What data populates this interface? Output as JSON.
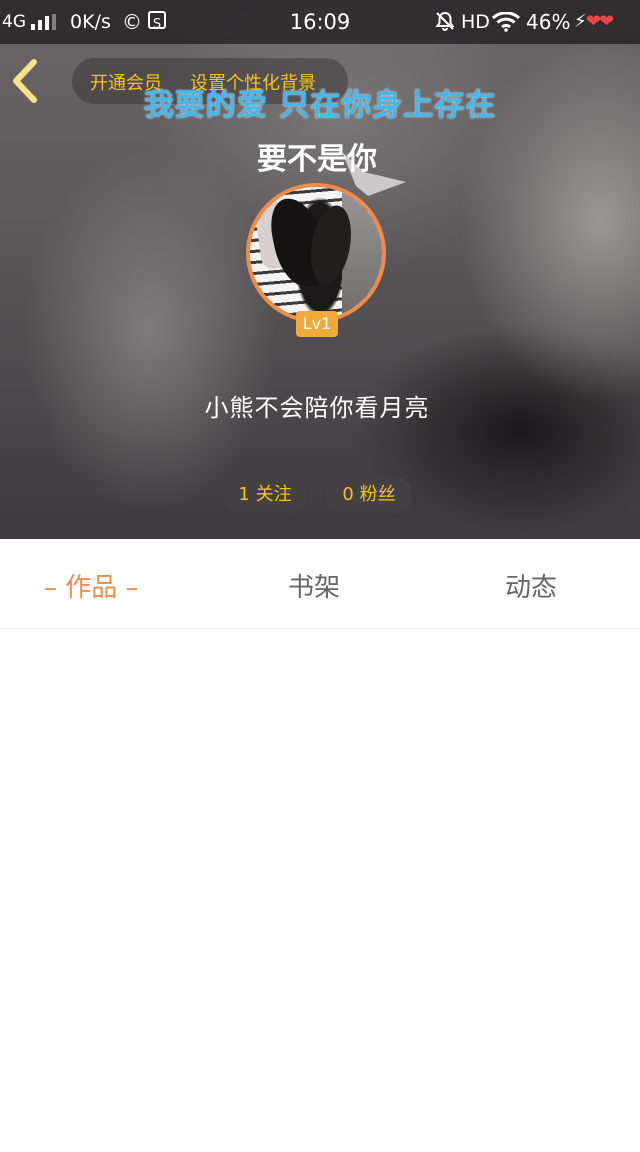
{
  "status_bar": {
    "network": "4G",
    "speed": "0K/s",
    "app_icon_1": "©",
    "app_icon_2": "S",
    "time": "16:09",
    "hd": "HD",
    "battery": "46%",
    "icons": [
      "signal-icon",
      "bell-muted-icon",
      "wifi-icon",
      "charging-icon",
      "heart-icon"
    ]
  },
  "header": {
    "vip_label": "开通会员",
    "background_label": "设置个性化背景",
    "lyric": "我要的爱 只在你身上存在",
    "song_title": "要不是你"
  },
  "profile": {
    "level": "Lv1",
    "nickname": "小熊不会陪你看月亮",
    "follow": "1 关注",
    "fans": "0 粉丝"
  },
  "tabs": [
    {
      "label": "– 作品 –",
      "active": true
    },
    {
      "label": "书架",
      "active": false
    },
    {
      "label": "动态",
      "active": false
    }
  ],
  "colors": {
    "accent": "#f08c4a",
    "gold": "#f5c518",
    "lyric_blue": "#46b7ea",
    "level_badge": "#f0a93a"
  }
}
